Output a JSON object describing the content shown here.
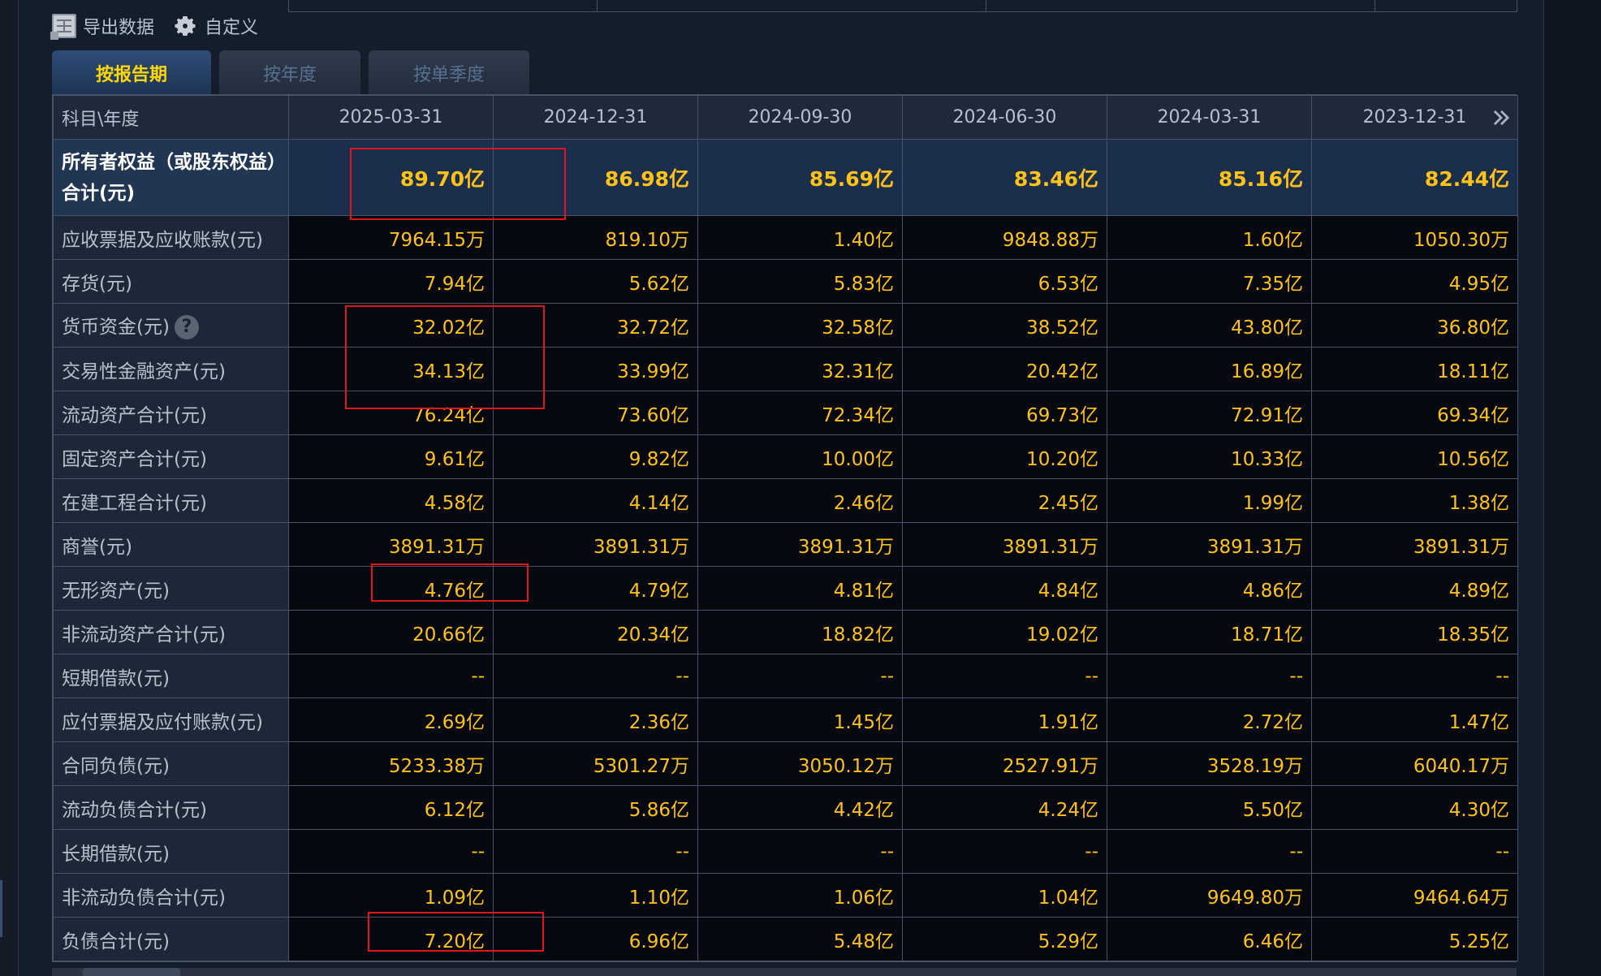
{
  "toolbar": {
    "export_label": "导出数据",
    "custom_label": "自定义"
  },
  "tabs": [
    {
      "label": "按报告期",
      "active": true
    },
    {
      "label": "按年度",
      "active": false
    },
    {
      "label": "按单季度",
      "active": false
    }
  ],
  "table": {
    "corner_label": "科目\\年度",
    "columns": [
      "2025-03-31",
      "2024-12-31",
      "2024-09-30",
      "2024-06-30",
      "2024-03-31",
      "2023-12-31"
    ],
    "rows": [
      {
        "label": "所有者权益（或股东权益）合计(元)",
        "values": [
          "89.70亿",
          "86.98亿",
          "85.69亿",
          "83.46亿",
          "85.16亿",
          "82.44亿"
        ]
      },
      {
        "label": "应收票据及应收账款(元)",
        "values": [
          "7964.15万",
          "819.10万",
          "1.40亿",
          "9848.88万",
          "1.60亿",
          "1050.30万"
        ]
      },
      {
        "label": "存货(元)",
        "values": [
          "7.94亿",
          "5.62亿",
          "5.83亿",
          "6.53亿",
          "7.35亿",
          "4.95亿"
        ]
      },
      {
        "label": "货币资金(元)",
        "help": "?",
        "values": [
          "32.02亿",
          "32.72亿",
          "32.58亿",
          "38.52亿",
          "43.80亿",
          "36.80亿"
        ]
      },
      {
        "label": "交易性金融资产(元)",
        "values": [
          "34.13亿",
          "33.99亿",
          "32.31亿",
          "20.42亿",
          "16.89亿",
          "18.11亿"
        ]
      },
      {
        "label": "流动资产合计(元)",
        "values": [
          "76.24亿",
          "73.60亿",
          "72.34亿",
          "69.73亿",
          "72.91亿",
          "69.34亿"
        ]
      },
      {
        "label": "固定资产合计(元)",
        "values": [
          "9.61亿",
          "9.82亿",
          "10.00亿",
          "10.20亿",
          "10.33亿",
          "10.56亿"
        ]
      },
      {
        "label": "在建工程合计(元)",
        "values": [
          "4.58亿",
          "4.14亿",
          "2.46亿",
          "2.45亿",
          "1.99亿",
          "1.38亿"
        ]
      },
      {
        "label": "商誉(元)",
        "values": [
          "3891.31万",
          "3891.31万",
          "3891.31万",
          "3891.31万",
          "3891.31万",
          "3891.31万"
        ]
      },
      {
        "label": "无形资产(元)",
        "values": [
          "4.76亿",
          "4.79亿",
          "4.81亿",
          "4.84亿",
          "4.86亿",
          "4.89亿"
        ]
      },
      {
        "label": "非流动资产合计(元)",
        "values": [
          "20.66亿",
          "20.34亿",
          "18.82亿",
          "19.02亿",
          "18.71亿",
          "18.35亿"
        ]
      },
      {
        "label": "短期借款(元)",
        "values": [
          "--",
          "--",
          "--",
          "--",
          "--",
          "--"
        ]
      },
      {
        "label": "应付票据及应付账款(元)",
        "values": [
          "2.69亿",
          "2.36亿",
          "1.45亿",
          "1.91亿",
          "2.72亿",
          "1.47亿"
        ]
      },
      {
        "label": "合同负债(元)",
        "values": [
          "5233.38万",
          "5301.27万",
          "3050.12万",
          "2527.91万",
          "3528.19万",
          "6040.17万"
        ]
      },
      {
        "label": "流动负债合计(元)",
        "values": [
          "6.12亿",
          "5.86亿",
          "4.42亿",
          "4.24亿",
          "5.50亿",
          "4.30亿"
        ]
      },
      {
        "label": "长期借款(元)",
        "values": [
          "--",
          "--",
          "--",
          "--",
          "--",
          "--"
        ]
      },
      {
        "label": "非流动负债合计(元)",
        "values": [
          "1.09亿",
          "1.10亿",
          "1.06亿",
          "1.04亿",
          "9649.80万",
          "9464.64万"
        ]
      },
      {
        "label": "负债合计(元)",
        "values": [
          "7.20亿",
          "6.96亿",
          "5.48亿",
          "5.29亿",
          "6.46亿",
          "5.25亿"
        ]
      }
    ]
  },
  "colors": {
    "value_text": "#ffc21a",
    "active_tab_text": "#ffd60a",
    "annotation_red": "#e0141b"
  }
}
